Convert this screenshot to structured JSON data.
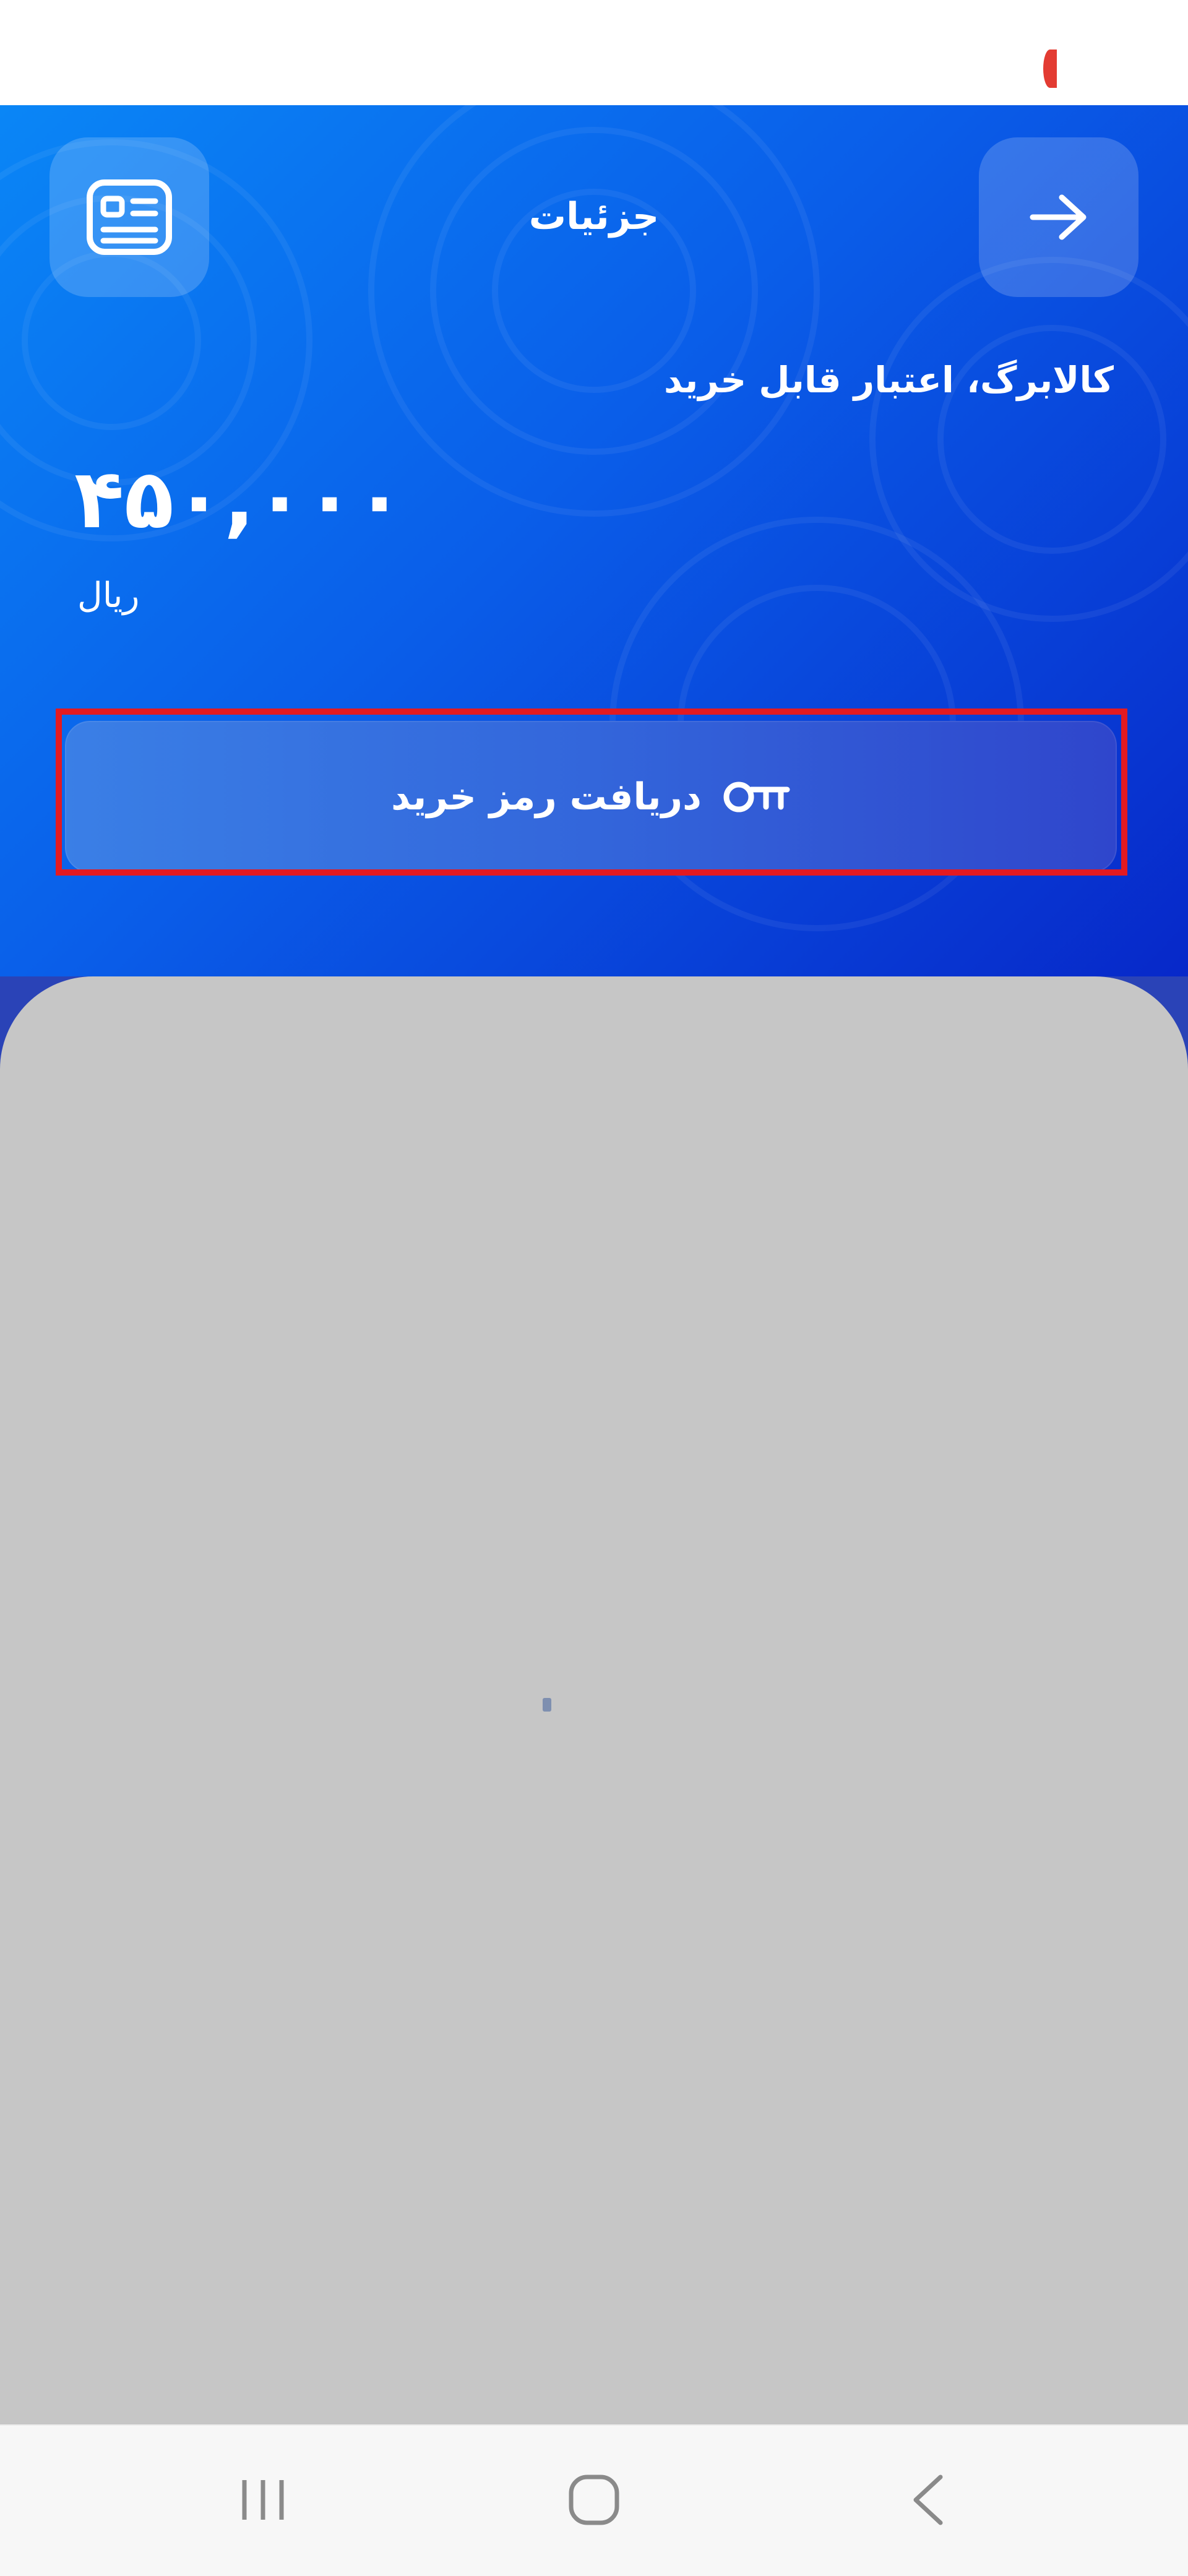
{
  "header": {
    "title": "جزئیات"
  },
  "hero": {
    "subtitle": "کالابرگ، اعتبار قابل خرید",
    "amount": "۴۵۰,۰۰۰",
    "currency": "ریال",
    "gradient": [
      "#0a86f6",
      "#0728c9"
    ]
  },
  "actions": {
    "get_code_label": "دریافت رمز خرید"
  },
  "icons": {
    "back": "arrow-right-icon",
    "details": "receipt-card-icon",
    "key": "key-icon",
    "nav_recents": "recents-icon",
    "nav_home": "home-icon",
    "nav_back": "back-chevron-icon"
  },
  "colors": {
    "highlight": "#e31a21",
    "sheet": "#c6c6c6",
    "status_dot": "#e33b32"
  }
}
